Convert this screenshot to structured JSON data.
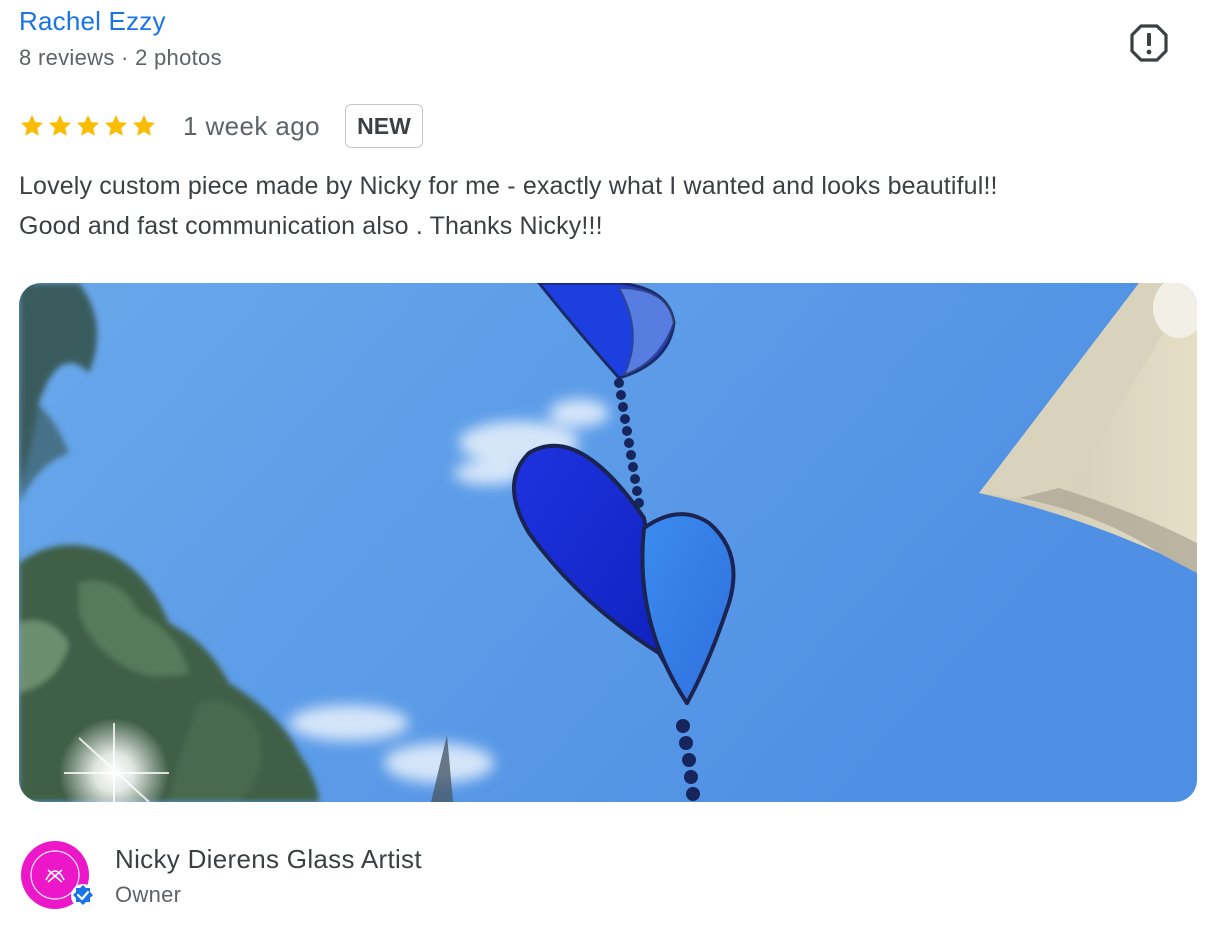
{
  "reviewer": {
    "name": "Rachel Ezzy",
    "stats": "8 reviews · 2 photos"
  },
  "report": {
    "icon": "report-octagon-icon"
  },
  "rating": {
    "stars": 5,
    "max_stars": 5,
    "star_color": "#fbbc04",
    "time_ago": "1 week ago",
    "badge": "NEW"
  },
  "review": {
    "lines": [
      "Lovely custom piece made by Nicky for me - exactly what I wanted and looks beautiful!!",
      "Good and fast communication also . Thanks Nicky!!!"
    ]
  },
  "photo": {
    "subject": "photo"
  },
  "owner": {
    "name": "Nicky Dierens Glass Artist",
    "role": "Owner",
    "avatar_color": "#ec17c8",
    "verified_color": "#1a73e8"
  },
  "colors": {
    "link": "#1a73e8",
    "text": "#3c4043",
    "secondary": "#5f6368"
  }
}
